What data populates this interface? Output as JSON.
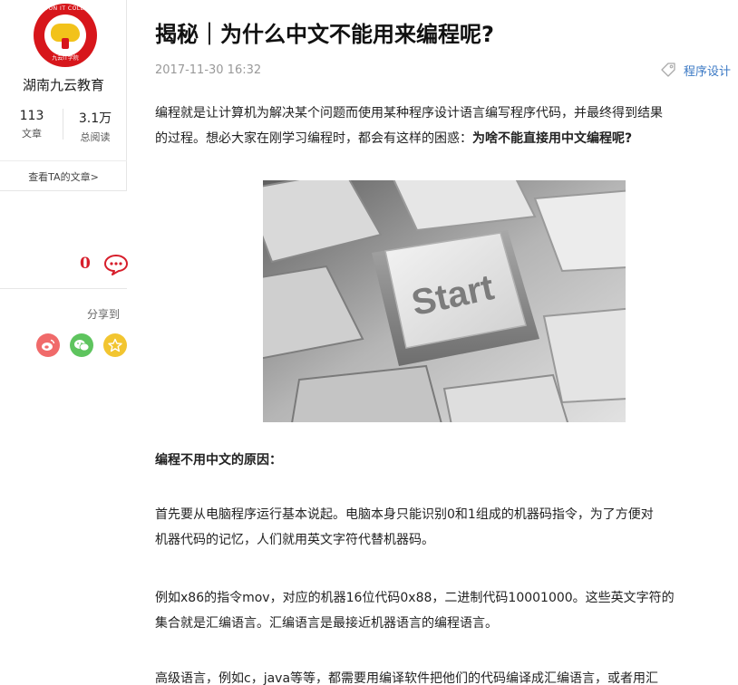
{
  "author": {
    "logo_ring_text": "JIU YUN IT COLLEGE",
    "logo_bottom_text": "九云IT学院",
    "name": "湖南九云教育",
    "articles_count": "113",
    "articles_label": "文章",
    "reads_count": "3.1万",
    "reads_label": "总阅读",
    "view_articles_link": "查看TA的文章>"
  },
  "engagement": {
    "comment_count": "0",
    "share_label": "分享到",
    "share_buttons": [
      {
        "name": "weibo",
        "color": "#f06a6a"
      },
      {
        "name": "wechat",
        "color": "#5ec45e"
      },
      {
        "name": "favorite",
        "color": "#f2c530"
      }
    ]
  },
  "article": {
    "title": "揭秘｜为什么中文不能用来编程呢?",
    "date": "2017-11-30 16:32",
    "tag": "程序设计",
    "intro_line1": "编程就是让计算机为解决某个问题而使用某种程序设计语言编写程序代码，并最终得到结果",
    "intro_line2_plain": "的过程。想必大家在刚学习编程时，都会有这样的困惑：",
    "intro_line2_bold": "为啥不能直接用中文编程呢?",
    "image_key_text": "Start",
    "section_heading": "编程不用中文的原因：",
    "p1_line1": "首先要从电脑程序运行基本说起。电脑本身只能识别0和1组成的机器码指令，为了方便对",
    "p1_line2": "机器代码的记忆，人们就用英文字符代替机器码。",
    "p2_line1": "例如x86的指令mov，对应的机器16位代码0x88，二进制代码10001000。这些英文字符的",
    "p2_line2": "集合就是汇编语言。汇编语言是最接近机器语言的编程语言。",
    "p3_line1": "高级语言，例如c，java等等，都需要用编译软件把他们的代码编译成汇编语言，或者用汇"
  },
  "colors": {
    "accent_red": "#d71e2b",
    "tag_blue": "#3a78c4",
    "logo_red": "#d7161b",
    "logo_yellow": "#f2c21b"
  }
}
